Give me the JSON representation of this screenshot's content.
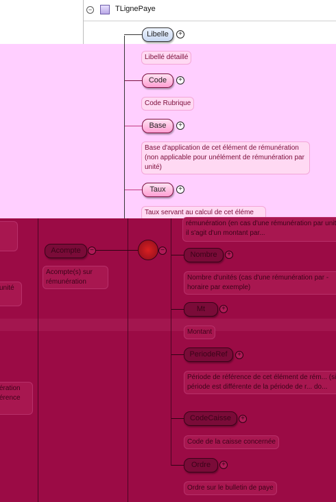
{
  "header": {
    "title": "TLignePaye",
    "collapse_symbol": "−"
  },
  "left_panel": {
    "acompte_label": "Acompte",
    "acompte_desc": "Acompte(s) sur rémunération",
    "cut_text_1": "unité",
    "cut_text_2a": "ération",
    "cut_text_2b": "érence"
  },
  "elements": [
    {
      "label": "Libelle",
      "desc": "Libellé détaillé"
    },
    {
      "label": "Code",
      "desc": "Code Rubrique"
    },
    {
      "label": "Base",
      "desc": "Base d'application de cet élément de rémunération (non applicable pour unélément de rémunération par unité)"
    },
    {
      "label": "Taux",
      "desc": "Taux servant au calcul de cet éléme"
    },
    {
      "desc_top": "rémunération (en cas d'une rémunération par unité, il s'agit d'un montant par..."
    },
    {
      "label": "Nombre",
      "desc": "Nombre d'unités (cas d'une rémunération par - horaire par exemple)"
    },
    {
      "label": "Mt",
      "desc": "Montant"
    },
    {
      "label": "PeriodeRef",
      "desc": "Période de référence de cet élément de rém... (si la période est différente de la période de r... do..."
    },
    {
      "label": "CodeCaisse",
      "desc": "Code de la caisse concernée"
    },
    {
      "label": "Ordre",
      "desc": "Ordre sur le bulletin de paye"
    }
  ],
  "plus_symbol": "+",
  "minus_symbol": "−",
  "colors": {
    "pink_overlay": "#ffcfff",
    "dark_overlay": "#9b0b45",
    "node_blue": "#c8d8f2",
    "node_pink": "#ff9fd3"
  }
}
